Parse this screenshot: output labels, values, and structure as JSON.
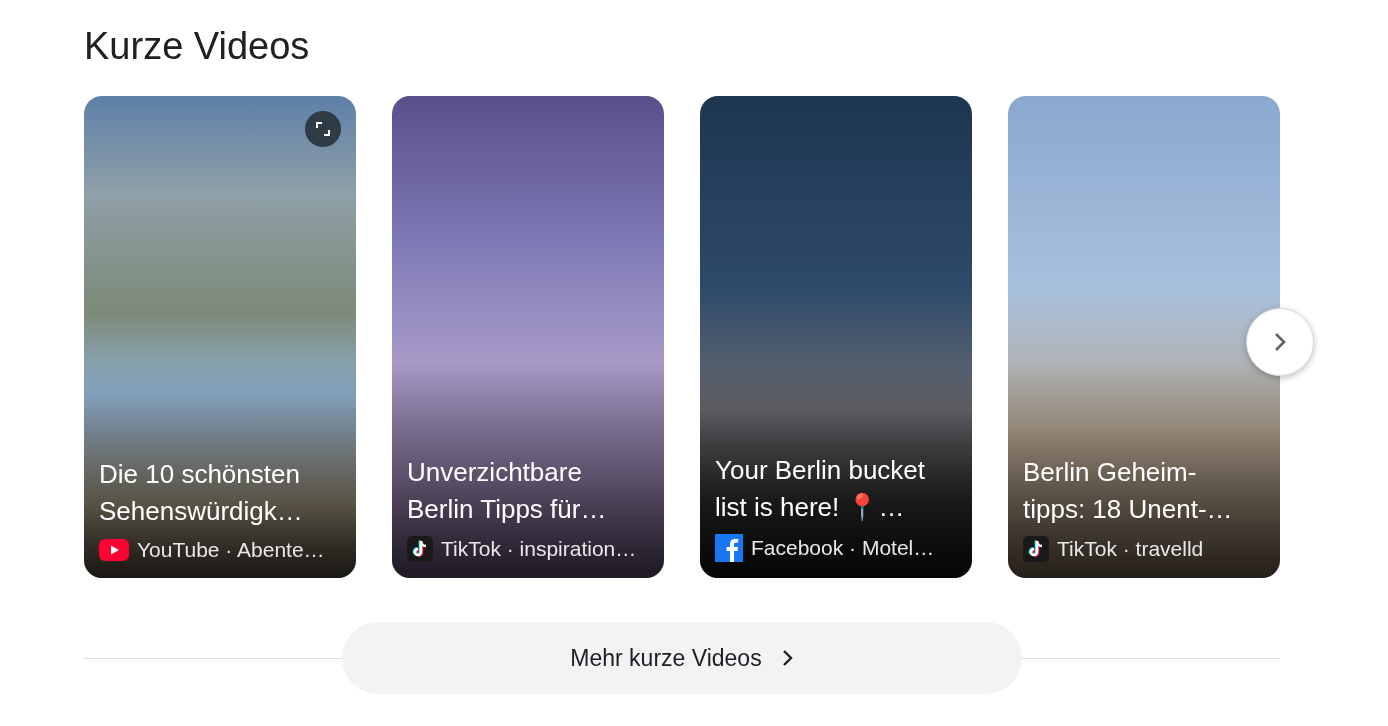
{
  "heading": "Kurze Videos",
  "videos": [
    {
      "title_lines": [
        "Die 10 schönsten",
        "Sehenswürdigk…"
      ],
      "kind": "youtube",
      "source": "YouTube · Abente…",
      "expand_button": true
    },
    {
      "title_lines": [
        "Unverzichtbare",
        "Berlin Tipps für…"
      ],
      "kind": "tiktok",
      "source": "TikTok · inspiration…",
      "expand_button": false
    },
    {
      "title_lines": [
        "Your Berlin bucket",
        "list is here! 📍…"
      ],
      "kind": "facebook",
      "source": "Facebook · Motel…",
      "expand_button": false
    },
    {
      "title_lines": [
        "Berlin Geheim-",
        "tipps: 18 Unent-…"
      ],
      "kind": "tiktok",
      "source": "TikTok · travelld",
      "expand_button": false
    }
  ],
  "more_button": "Mehr kurze Videos"
}
